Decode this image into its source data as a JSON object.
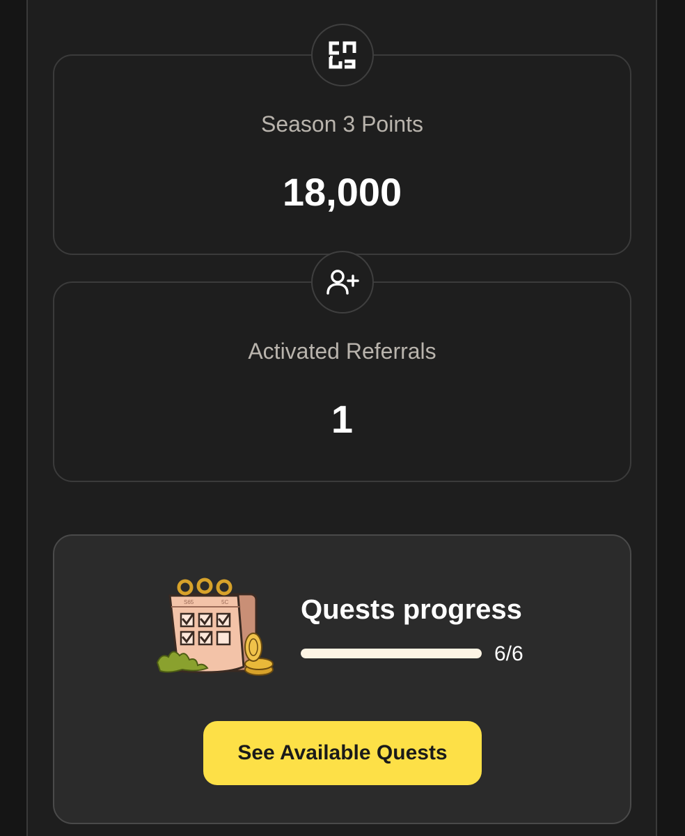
{
  "season_points": {
    "icon": "brand-logo-icon",
    "label": "Season 3 Points",
    "value": "18,000"
  },
  "referrals": {
    "icon": "add-user-icon",
    "label": "Activated Referrals",
    "value": "1"
  },
  "quests": {
    "illustration": "quest-calendar-illustration",
    "title": "Quests progress",
    "progress_count": "6/6",
    "progress_fraction": 1.0,
    "button_label": "See Available Quests"
  },
  "colors": {
    "accent_button": "#fde047",
    "progress_fill": "#fdf4e4",
    "background": "#1e1e1e"
  }
}
